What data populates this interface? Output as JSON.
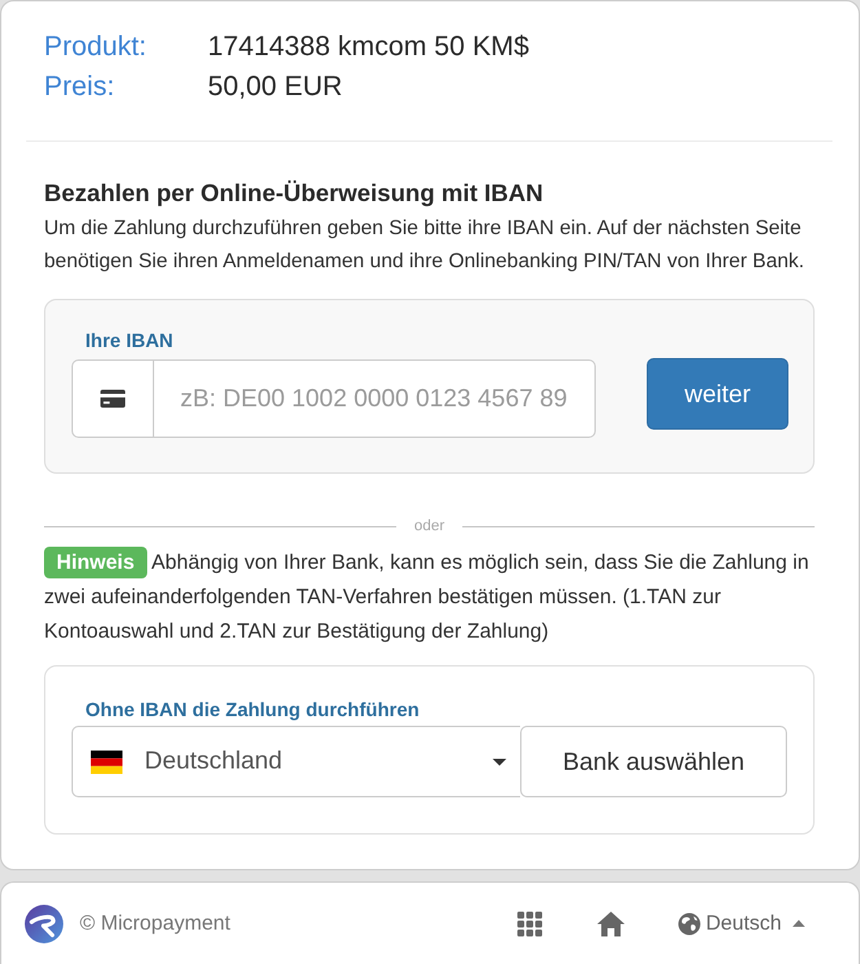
{
  "product": {
    "rows": [
      {
        "label": "Produkt:",
        "value": "17414388 kmcom 50 KM$"
      },
      {
        "label": "Preis:",
        "value": "50,00 EUR"
      }
    ]
  },
  "iban_payment": {
    "heading": "Bezahlen per Online-Überweisung mit IBAN",
    "description": "Um die Zahlung durchzuführen geben Sie bitte ihre IBAN ein. Auf der nächsten Seite benötigen Sie ihren Anmeldenamen und ihre Onlinebanking PIN/TAN von Ihrer Bank.",
    "field_label": "Ihre IBAN",
    "placeholder": "zB: DE00 1002 0000 0123 4567 89",
    "button": "weiter"
  },
  "divider": {
    "label": "oder"
  },
  "notice": {
    "badge": "Hinweis",
    "text": "Abhängig von Ihrer Bank, kann es möglich sein, dass Sie die Zahlung in zwei aufeinanderfolgenden TAN-Verfahren bestätigen müssen. (1.TAN zur Kontoauswahl und 2.TAN zur Bestätigung der Zahlung)"
  },
  "bank_selection": {
    "label": "Ohne IBAN die Zahlung durchführen",
    "country": "Deutschland",
    "button": "Bank auswählen"
  },
  "footer": {
    "copyright": "© Micropayment",
    "language": "Deutsch"
  }
}
